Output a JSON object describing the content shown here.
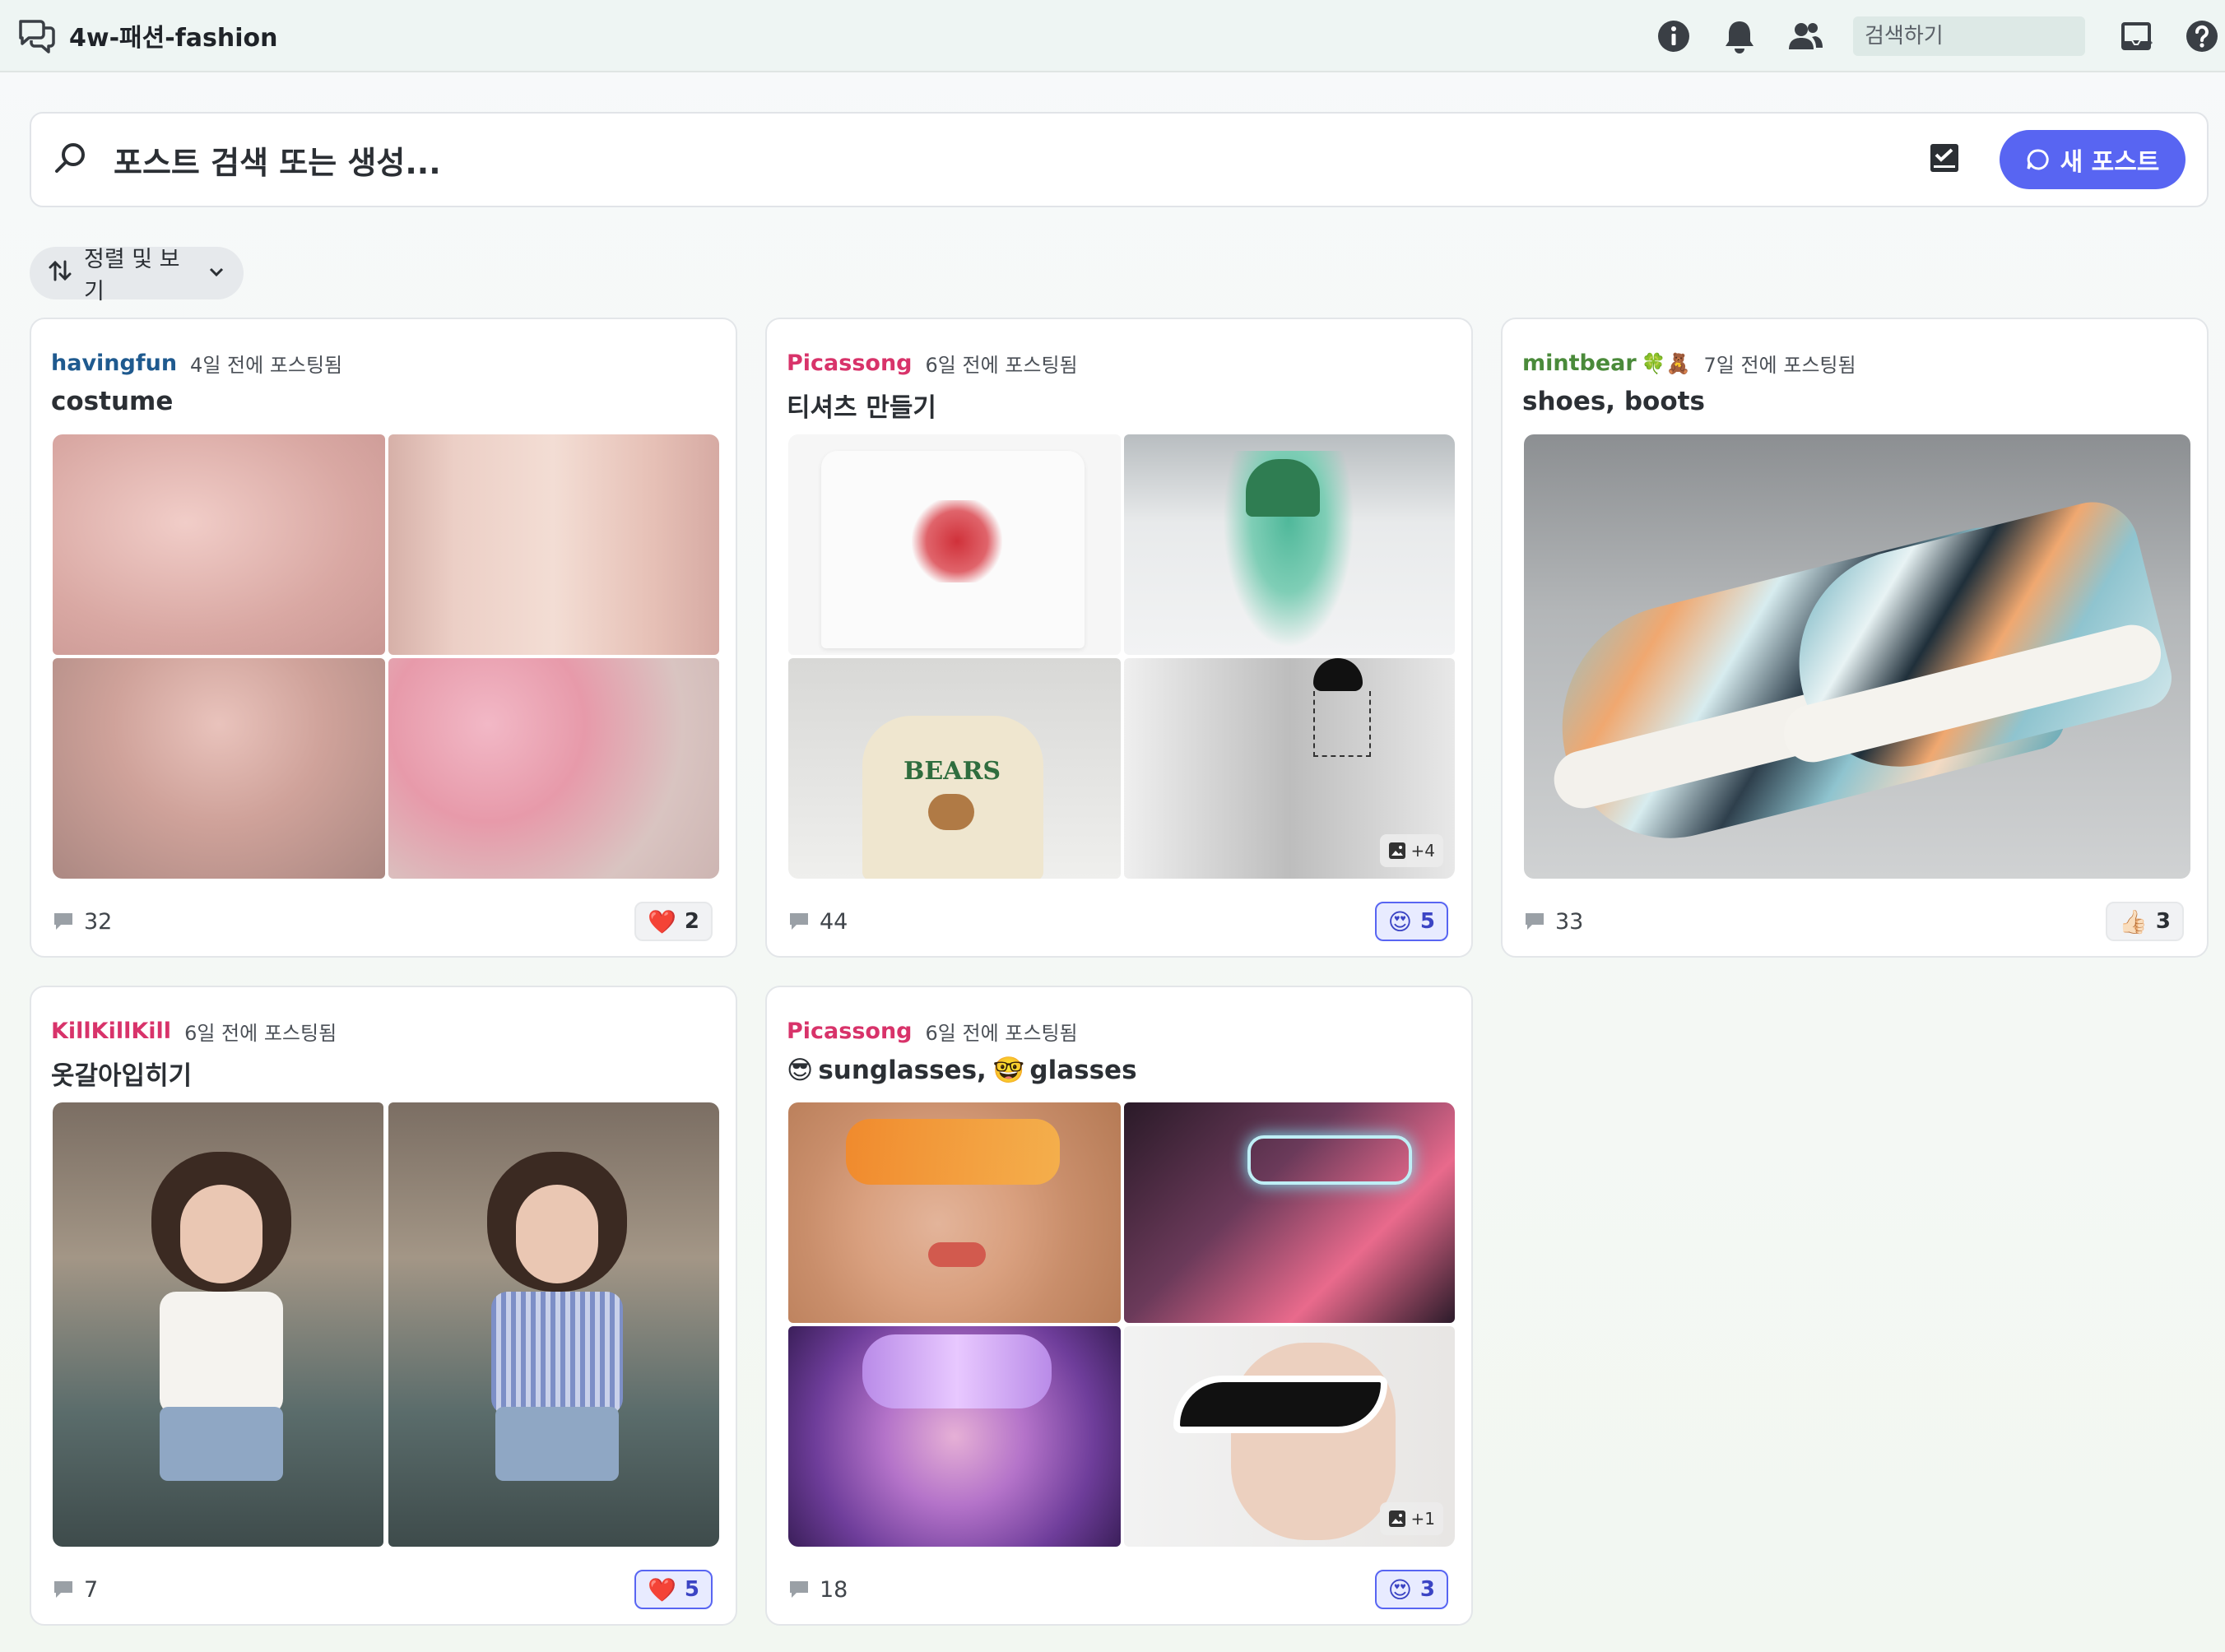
{
  "header": {
    "channel_name": "4w-패션-fashion",
    "search_placeholder": "검색하기"
  },
  "post_search": {
    "placeholder": "포스트 검색 또는 생성...",
    "new_post_label": "새 포스트"
  },
  "sort": {
    "label": "정렬 및 보기"
  },
  "posts": [
    {
      "author": "havingfun",
      "author_color": "#1f5a8f",
      "ago": "4일 전에 포스팅됨",
      "title": "costume",
      "comments": "32",
      "reaction_emoji": "❤️",
      "reaction_count": "2",
      "reaction_active": false,
      "images": [
        "pink draped robe",
        "pink ruffled gown",
        "pink headwrap portrait",
        "pink hats duo"
      ],
      "more": ""
    },
    {
      "author": "Picassong",
      "author_color": "#d8336a",
      "ago": "6일 전에 포스팅됨",
      "title": "티셔츠 만들기",
      "comments": "44",
      "reaction_emoji": "😍",
      "reaction_count": "5",
      "reaction_active": true,
      "images": [
        "heart t-shirt",
        "green bear sweatshirt",
        "BEARS sweatshirt",
        "cat pocket t-shirt"
      ],
      "more": "+4"
    },
    {
      "author": "mintbear",
      "author_badges": "🍀🧸",
      "author_color": "#4a8a3a",
      "ago": "7일 전에 포스팅됨",
      "title": "shoes, boots",
      "comments": "33",
      "reaction_emoji": "👍🏻",
      "reaction_count": "3",
      "reaction_active": false,
      "images": [
        "geometric pattern sneakers"
      ],
      "more": ""
    },
    {
      "author": "KillKillKill",
      "author_color": "#d8336a",
      "ago": "6일 전에 포스팅됨",
      "title": "옷갈아입히기",
      "comments": "7",
      "reaction_emoji": "❤️",
      "reaction_count": "5",
      "reaction_active": true,
      "images": [
        "girl with mouse ears white top",
        "girl with mouse ears striped shirt"
      ],
      "more": ""
    },
    {
      "author": "Picassong",
      "author_color": "#d8336a",
      "ago": "6일 전에 포스팅됨",
      "title_emoji1": "😎",
      "title_part1": "sunglasses,",
      "title_emoji2": "🤓",
      "title_part2": "glasses",
      "comments": "18",
      "reaction_emoji": "😍",
      "reaction_count": "3",
      "reaction_active": true,
      "images": [
        "orange shield sunglasses",
        "clear futuristic glasses",
        "purple goggles",
        "white cat-eye sunglasses"
      ],
      "more": "+1"
    }
  ],
  "colors": {
    "accent": "#5865f2",
    "topbar_bg": "#eef5f3"
  }
}
